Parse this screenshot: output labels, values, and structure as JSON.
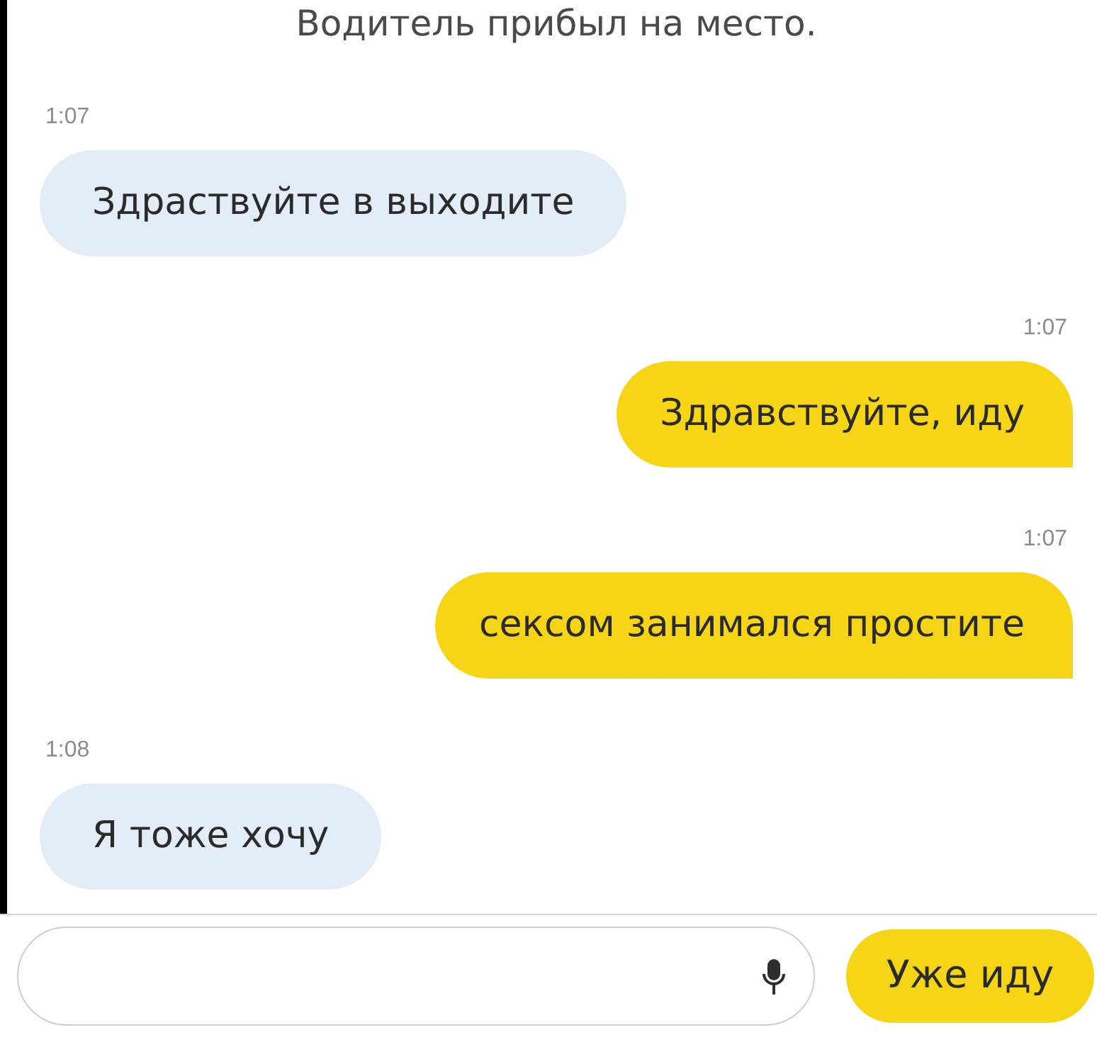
{
  "header": {
    "title": "Водитель прибыл на место."
  },
  "messages": [
    {
      "kind": "incoming",
      "time": "1:07",
      "text": "Здраствуйте в выходите"
    },
    {
      "kind": "outgoing",
      "time": "1:07",
      "text": "Здравствуйте, иду"
    },
    {
      "kind": "outgoing",
      "time": "1:07",
      "text": "сексом занимался простите"
    },
    {
      "kind": "incoming",
      "time": "1:08",
      "text": "Я тоже хочу"
    }
  ],
  "composer": {
    "quick_reply": "Уже иду"
  }
}
